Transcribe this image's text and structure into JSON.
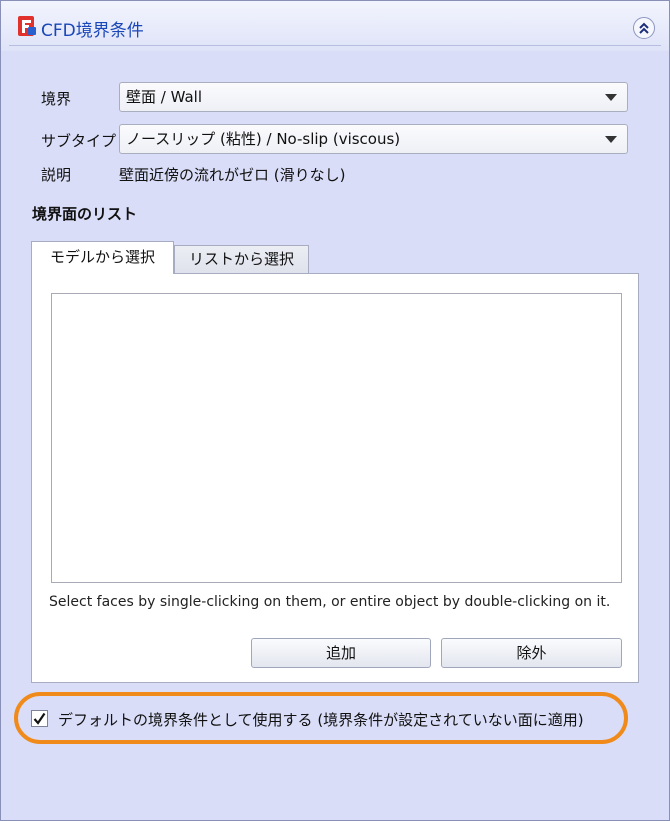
{
  "panel": {
    "title": "CFD境界条件",
    "icons": {
      "logo": "freecad-logo-icon",
      "collapse": "double-chevron-up-icon"
    }
  },
  "form": {
    "boundary_label": "境界",
    "boundary_value": "壁面 / Wall",
    "subtype_label": "サブタイプ",
    "subtype_value": "ノースリップ (粘性) / No-slip (viscous)",
    "description_label": "説明",
    "description_value": "壁面近傍の流れがゼロ (滑りなし)"
  },
  "faces": {
    "section_title": "境界面のリスト",
    "tabs": [
      {
        "label": "モデルから選択",
        "active": true
      },
      {
        "label": "リストから選択",
        "active": false
      }
    ],
    "hint": "Select faces by single-clicking on them, or entire object by double-clicking on it.",
    "add_label": "追加",
    "remove_label": "除外"
  },
  "default_option": {
    "checked": true,
    "label": "デフォルトの境界条件として使用する (境界条件が設定されていない面に適用)"
  },
  "colors": {
    "panel_background": "#d9ddf7",
    "title_text": "#1a47b8",
    "highlight": "#f08a1a",
    "logo_red": "#e0312c",
    "logo_blue": "#2a5fd0"
  }
}
